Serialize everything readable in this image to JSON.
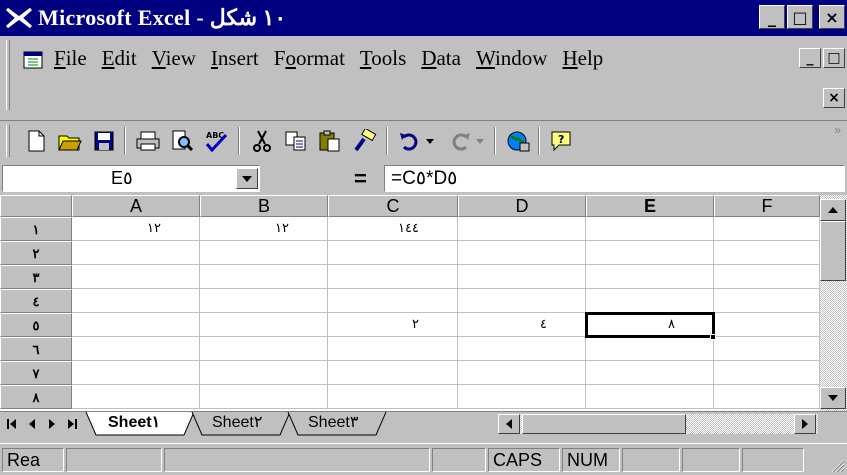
{
  "window": {
    "title": "Microsoft Excel - ١٠ شكل",
    "minimize_label": "_",
    "restore_label": "□",
    "close_label": "×"
  },
  "menu": {
    "items": [
      {
        "key": "F",
        "rest": "ile"
      },
      {
        "key": "E",
        "rest": "dit"
      },
      {
        "key": "V",
        "rest": "iew"
      },
      {
        "key": "I",
        "rest": "nsert"
      },
      {
        "key": "F",
        "pre": "F",
        "post": "ormat",
        "under": "o"
      },
      {
        "key": "T",
        "rest": "ools"
      },
      {
        "key": "D",
        "rest": "ata"
      },
      {
        "key": "W",
        "rest": "indow"
      },
      {
        "key": "H",
        "rest": "elp"
      }
    ],
    "doc_min": "_",
    "doc_restore": "□",
    "doc_close": "×"
  },
  "toolbar": {
    "icons": [
      "new-icon",
      "open-icon",
      "save-icon",
      "print-icon",
      "print-preview-icon",
      "spelling-icon",
      "cut-icon",
      "copy-icon",
      "paste-icon",
      "format-painter-icon",
      "undo-icon",
      "redo-icon",
      "web-toolbar-icon",
      "office-assistant-icon"
    ],
    "more": "»"
  },
  "formula_bar": {
    "name_box": "E٥",
    "equals": "=",
    "formula": "=C٥*D٥"
  },
  "columns": [
    "A",
    "B",
    "C",
    "D",
    "E",
    "F"
  ],
  "active_column": "E",
  "rows": [
    "١",
    "٢",
    "٣",
    "٤",
    "٥",
    "٦",
    "٧",
    "٨"
  ],
  "active_row": "٥",
  "cells": {
    "A1": "١٢",
    "B1": "١٢",
    "C1": "١٤٤",
    "C5": "٢",
    "D5": "٤",
    "E5": "٨"
  },
  "sheets": {
    "tabs": [
      "Sheet١",
      "Sheet٢",
      "Sheet٣"
    ],
    "active": "Sheet١"
  },
  "status": {
    "ready": "Rea",
    "caps": "CAPS",
    "num": "NUM"
  }
}
